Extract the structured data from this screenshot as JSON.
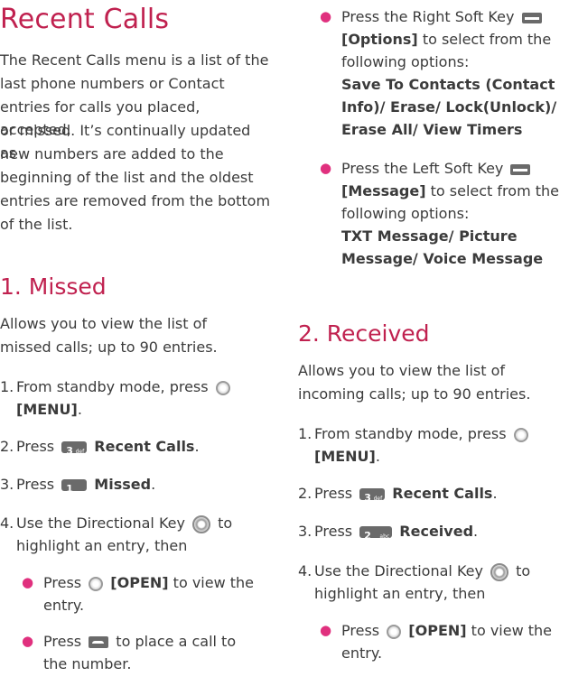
{
  "left": {
    "title": "Recent Calls",
    "intro": [
      "The Recent Calls menu is a list of the",
      "last phone numbers or Contact",
      "entries for calls you placed, accepted,",
      "or missed. It’s continually updated as",
      "new numbers are added to the",
      "beginning of the list and the oldest",
      "entries are removed from the bottom",
      "of the list."
    ],
    "missed_heading": "1. Missed",
    "missed_desc": [
      "Allows you to view the list of",
      "missed calls; up to 90 entries."
    ],
    "step1": {
      "num": "1.",
      "a": "From standby mode, press",
      "menu": "[MENU]",
      "end": "."
    },
    "step2": {
      "num": "2.",
      "a": "Press",
      "b": "Recent Calls",
      "end": "."
    },
    "step3": {
      "num": "3.",
      "a": "Press",
      "b": "Missed",
      "end": "."
    },
    "step4": {
      "num": "4.",
      "a": "Use the Directional Key",
      "b": "to",
      "c": "highlight an entry, then"
    },
    "bullet1": {
      "a": "Press",
      "b": "[OPEN]",
      "c": "to  view the",
      "d": "entry."
    },
    "bullet2": {
      "a": "Press",
      "b": "to place a call to",
      "c": "the number."
    }
  },
  "right": {
    "bullet3": {
      "a": "Press the Right Soft Key",
      "b": "[Options]",
      "c": "to select from the",
      "d": "following options:",
      "opts": [
        "Save To Contacts (Contact",
        "Info)/ Erase/ Lock(Unlock)/",
        "Erase All/ View Timers"
      ]
    },
    "bullet4": {
      "a": "Press the Left Soft Key",
      "b": "[Message]",
      "c": "to select from the",
      "d": "following options:",
      "opts": [
        "TXT Message/ Picture",
        "Message/ Voice Message"
      ]
    },
    "received_heading": "2. Received",
    "received_desc": [
      "Allows you to view the list of",
      "incoming calls; up to 90 entries."
    ],
    "step1": {
      "num": "1.",
      "a": "From standby mode, press",
      "menu": "[MENU]",
      "end": "."
    },
    "step2": {
      "num": "2.",
      "a": "Press",
      "b": "Recent Calls",
      "end": "."
    },
    "step3": {
      "num": "3.",
      "a": "Press",
      "b": "Received",
      "end": "."
    },
    "step4": {
      "num": "4.",
      "a": "Use the Directional Key",
      "b": "to",
      "c": "highlight an entry, then"
    },
    "bullet5": {
      "a": "Press",
      "b": "[OPEN]",
      "c": "to view the",
      "d": "entry."
    }
  },
  "keys": {
    "key3": "3",
    "key3_sub": "def",
    "key1": "1",
    "key2": "2",
    "key2_sub": "abc"
  }
}
